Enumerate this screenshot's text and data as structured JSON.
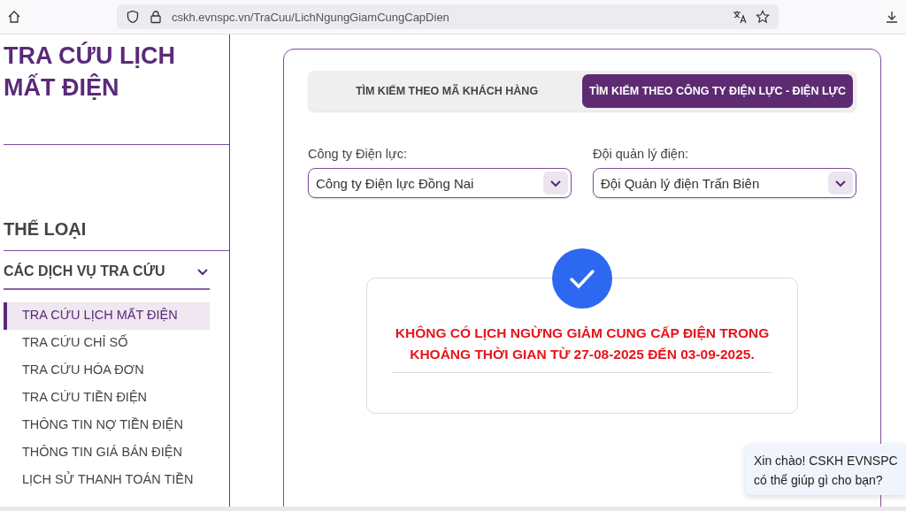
{
  "browser": {
    "url": "cskh.evnspc.vn/TraCuu/LichNgungGiamCungCapDien"
  },
  "sidebar": {
    "title": "TRA CỨU LỊCH MẤT ĐIỆN",
    "category_heading": "THỂ LOẠI",
    "section": {
      "label": "CÁC DỊCH VỤ TRA CỨU",
      "expanded": true
    },
    "items": [
      {
        "label": "TRA CỨU LỊCH MẤT ĐIỆN",
        "selected": true
      },
      {
        "label": "TRA CỨU CHỈ SỐ",
        "selected": false
      },
      {
        "label": "TRA CỨU HÓA ĐƠN",
        "selected": false
      },
      {
        "label": "TRA CỨU TIỀN ĐIỆN",
        "selected": false
      },
      {
        "label": "THÔNG TIN NỢ TIỀN ĐIỆN",
        "selected": false
      },
      {
        "label": "THÔNG TIN GIÁ BÁN ĐIỆN",
        "selected": false
      },
      {
        "label": "LỊCH SỬ THANH TOÁN TIỀN",
        "selected": false
      }
    ]
  },
  "tabs": [
    {
      "label": "TÌM KIẾM THEO MÃ KHÁCH HÀNG",
      "selected": false
    },
    {
      "label": "TÌM KIẾM THEO CÔNG TY ĐIỆN LỰC - ĐIỆN LỰC",
      "selected": true
    }
  ],
  "fields": [
    {
      "label": "Công ty Điện lực:",
      "value": "Công ty Điện lực Đồng Nai"
    },
    {
      "label": "Đội quản lý điện:",
      "value": "Đội Quản lý điện Trấn Biên"
    }
  ],
  "result": {
    "message": "KHÔNG CÓ LỊCH NGỪNG GIẢM CUNG CẤP ĐIỆN TRONG KHOẢNG THỜI GIAN TỪ 27-08-2025 ĐẾN 03-09-2025."
  },
  "chat_bubble": {
    "text": "Xin chào! CSKH EVNSPC có thể giúp gì cho bạn?"
  }
}
